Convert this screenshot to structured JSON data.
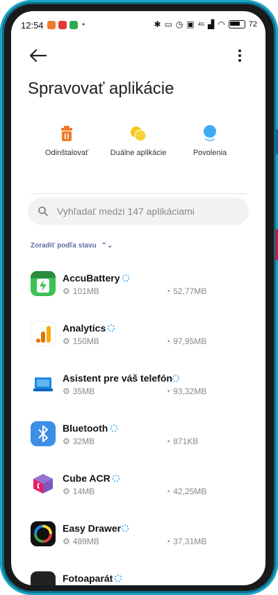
{
  "status_bar": {
    "time": "12:54",
    "battery": "72",
    "net": "4G"
  },
  "header": {
    "title": "Spravovať aplikácie"
  },
  "actions": [
    {
      "label": "Odinštalovať",
      "icon": "trash-icon",
      "color": "#f2792b"
    },
    {
      "label": "Duálne aplikácie",
      "icon": "dual-apps-icon",
      "color": "#f7c41a"
    },
    {
      "label": "Povolenia",
      "icon": "permissions-icon",
      "color": "#3fa9f5"
    }
  ],
  "search": {
    "placeholder": "Vyhľadať medzi 147 aplikáciami"
  },
  "sort": {
    "label": "Zoradiť podľa stavu"
  },
  "apps": [
    {
      "name": "AccuBattery",
      "size": "101MB",
      "data": "52,77MB"
    },
    {
      "name": "Analytics",
      "size": "150MB",
      "data": "97,95MB"
    },
    {
      "name": "Asistent pre váš telefón",
      "size": "35MB",
      "data": "93,32MB"
    },
    {
      "name": "Bluetooth",
      "size": "32MB",
      "data": "871KB"
    },
    {
      "name": "Cube ACR",
      "size": "14MB",
      "data": "42,25MB"
    },
    {
      "name": "Easy Drawer",
      "size": "489MB",
      "data": "37,31MB"
    },
    {
      "name": "Fotoaparát",
      "size": "",
      "data": ""
    }
  ]
}
